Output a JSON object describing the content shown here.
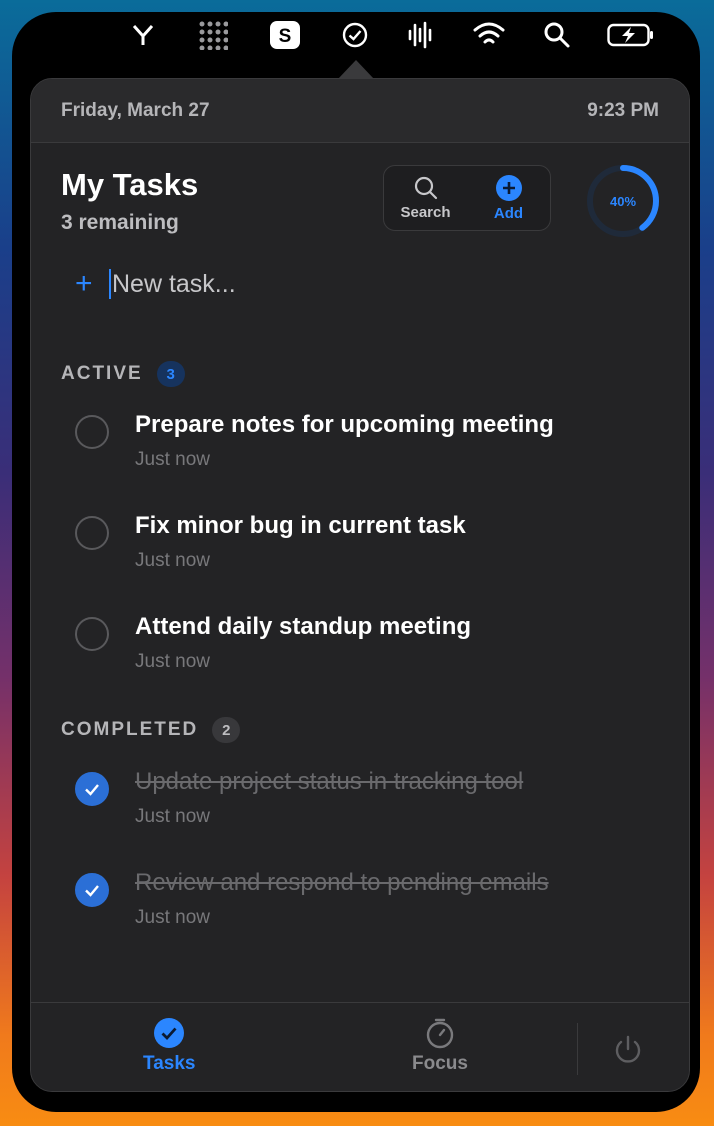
{
  "menubar": {
    "icons": [
      "y-combinator-icon",
      "grid-icon",
      "s-app-icon",
      "tasks-check-icon",
      "audio-waveform-icon",
      "wifi-icon",
      "search-icon",
      "battery-charging-icon"
    ]
  },
  "header": {
    "date": "Friday, March 27",
    "time": "9:23 PM"
  },
  "main": {
    "title": "My Tasks",
    "remaining": "3 remaining",
    "search_label": "Search",
    "add_label": "Add",
    "progress": {
      "percent": 40,
      "label": "40%"
    },
    "new_task_placeholder": "New task..."
  },
  "sections": {
    "active": {
      "label": "ACTIVE",
      "count": "3"
    },
    "completed": {
      "label": "COMPLETED",
      "count": "2"
    }
  },
  "tasks": {
    "active": [
      {
        "title": "Prepare notes for upcoming meeting",
        "time": "Just now"
      },
      {
        "title": "Fix minor bug in current task",
        "time": "Just now"
      },
      {
        "title": "Attend daily standup meeting",
        "time": "Just now"
      }
    ],
    "completed": [
      {
        "title": "Update project status in tracking tool",
        "time": "Just now"
      },
      {
        "title": "Review and respond to pending emails",
        "time": "Just now"
      }
    ]
  },
  "footer": {
    "tasks_label": "Tasks",
    "focus_label": "Focus"
  },
  "colors": {
    "accent": "#2b86ff",
    "panel": "#232325",
    "check_done": "#2b6fd6"
  }
}
